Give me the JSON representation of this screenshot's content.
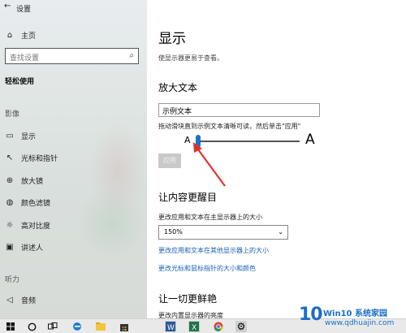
{
  "window": {
    "title": "设置"
  },
  "sidebar": {
    "home_label": "主页",
    "search_placeholder": "查找设置",
    "section_title": "轻松使用",
    "group_vision": "影像",
    "group_hearing": "听力",
    "items": [
      {
        "label": "显示",
        "icon": "monitor-icon"
      },
      {
        "label": "光标和指针",
        "icon": "cursor-icon"
      },
      {
        "label": "放大镜",
        "icon": "magnifier-icon"
      },
      {
        "label": "颜色滤镜",
        "icon": "color-filter-icon"
      },
      {
        "label": "高对比度",
        "icon": "high-contrast-icon"
      },
      {
        "label": "讲述人",
        "icon": "narrator-icon"
      },
      {
        "label": "音频",
        "icon": "speaker-icon"
      }
    ]
  },
  "main": {
    "title": "显示",
    "subtitle": "使显示器更易于查看。",
    "text_size": {
      "heading": "放大文本",
      "sample_text": "示例文本",
      "hint": "拖动滑块直到示例文本清晰可读，然后单击\"应用\"",
      "small_a": "A",
      "large_a": "A",
      "slider_level": 0,
      "apply_label": "应用"
    },
    "bigger": {
      "heading": "让内容更醒目",
      "scale_label": "更改应用和文本在主显示器上的大小",
      "scale_value": "150%",
      "link_other_displays": "更改应用和文本在其他显示器上的大小",
      "link_cursor": "更改光标和鼠标指针的大小和颜色"
    },
    "brighter": {
      "heading": "让一切更鲜艳",
      "partial_label": "更改内置显示器的亮度"
    }
  },
  "taskbar": {
    "icons": [
      "windows-start-icon",
      "cortana-icon",
      "task-view-icon",
      "edge-icon",
      "file-explorer-icon",
      "store-icon",
      "word-icon",
      "excel-icon",
      "chrome-icon",
      "settings-icon"
    ]
  },
  "watermark": {
    "logo_text": "10",
    "title": "Win10 系统家园",
    "url": "www.qdhuajin.com"
  },
  "colors": {
    "accent": "#1a73c8",
    "link": "#1a5fb4",
    "annotation": "#e03030"
  }
}
